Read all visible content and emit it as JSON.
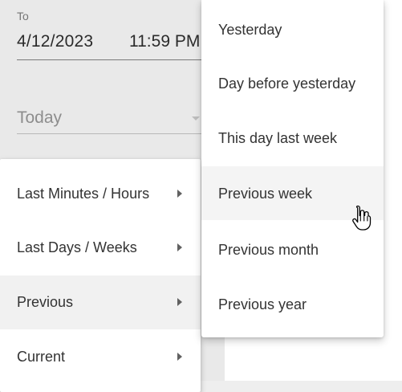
{
  "date_range": {
    "to_label": "To",
    "to_date": "4/12/2023",
    "to_time": "11:59 PM",
    "preset_value": "Today"
  },
  "menu": {
    "items": [
      {
        "label": "Last Minutes / Hours"
      },
      {
        "label": "Last Days / Weeks"
      },
      {
        "label": "Previous"
      },
      {
        "label": "Current"
      }
    ]
  },
  "submenu": {
    "items": [
      {
        "label": "Yesterday"
      },
      {
        "label": "Day before yesterday"
      },
      {
        "label": "This day last week"
      },
      {
        "label": "Previous week"
      },
      {
        "label": "Previous month"
      },
      {
        "label": "Previous year"
      }
    ]
  },
  "icons": {
    "menu_arrow": "chevron-right-icon",
    "select_caret": "caret-down-icon",
    "pointer": "hand-pointer-icon"
  },
  "colors": {
    "panel_bg": "#e9e9e9",
    "menu_bg": "#ffffff",
    "hover_bg": "#f1f1f1",
    "text": "#333333",
    "muted": "#8d8d8d"
  }
}
